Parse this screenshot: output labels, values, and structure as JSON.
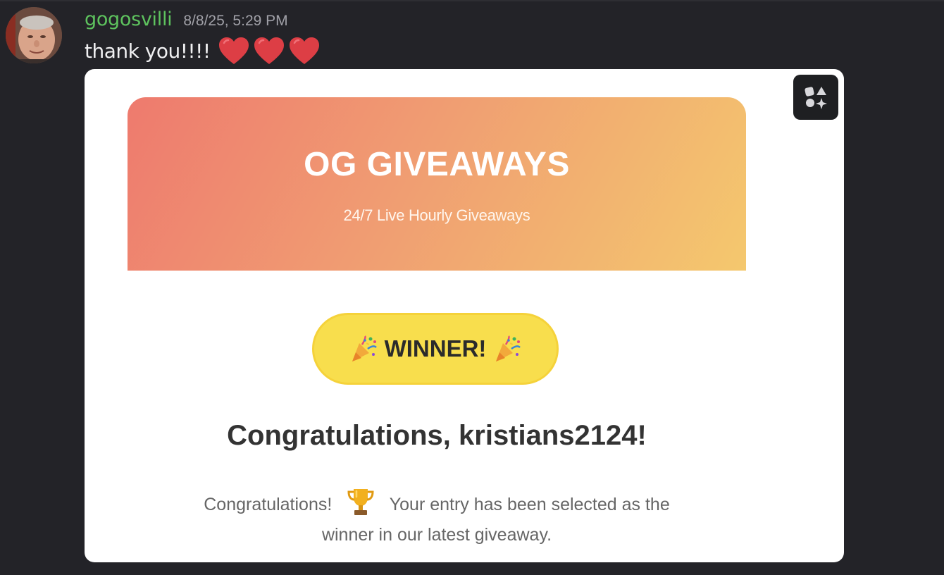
{
  "message": {
    "username": "gogosvilli",
    "timestamp": "8/8/25, 5:29 PM",
    "text": "thank you!!!!",
    "reactions_inline": [
      "heart-emoji",
      "heart-emoji",
      "heart-emoji"
    ]
  },
  "embed": {
    "banner": {
      "title": "OG GIVEAWAYS",
      "subtitle": "24/7 Live Hourly Giveaways"
    },
    "winner_badge": "WINNER!",
    "heading": "Congratulations, kristians2124!",
    "body_before_icon": "Congratulations!",
    "body_after_icon": "Your entry has been selected as the winner in our latest giveaway.",
    "apps_button_icon": "apps-icon"
  },
  "colors": {
    "username": "#5ec35e",
    "background": "#232328",
    "banner_start": "#ee7a6e",
    "banner_end": "#f4c86e",
    "winner_pill": "#f8de4d",
    "heart": "#dd3e45"
  }
}
